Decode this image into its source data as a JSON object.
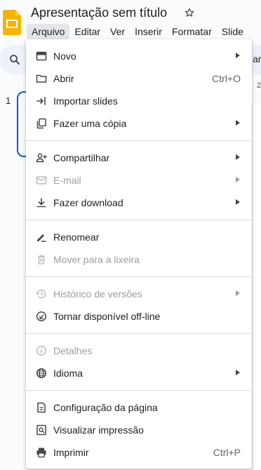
{
  "app": {
    "title": "Apresentação sem título"
  },
  "menubar": {
    "items": [
      "Arquivo",
      "Editar",
      "Ver",
      "Inserir",
      "Formatar",
      "Slide"
    ]
  },
  "background": {
    "toolbar_tail": "ar",
    "filmstrip_number": "1",
    "ruler_number": "2"
  },
  "file_menu": {
    "items": [
      {
        "label": "Novo",
        "icon": "new-presentation-icon",
        "submenu": true,
        "disabled": false
      },
      {
        "label": "Abrir",
        "icon": "folder-icon",
        "shortcut": "Ctrl+O",
        "disabled": false
      },
      {
        "label": "Importar slides",
        "icon": "import-icon",
        "disabled": false
      },
      {
        "label": "Fazer uma cópia",
        "icon": "copy-icon",
        "submenu": true,
        "disabled": false
      },
      {
        "label": "Compartilhar",
        "icon": "share-person-icon",
        "submenu": true,
        "disabled": false
      },
      {
        "label": "E-mail",
        "icon": "mail-icon",
        "submenu": true,
        "disabled": true
      },
      {
        "label": "Fazer download",
        "icon": "download-icon",
        "submenu": true,
        "disabled": false
      },
      {
        "label": "Renomear",
        "icon": "rename-icon",
        "disabled": false
      },
      {
        "label": "Mover para a lixeira",
        "icon": "trash-icon",
        "disabled": true
      },
      {
        "label": "Histórico de versões",
        "icon": "history-icon",
        "submenu": true,
        "disabled": true
      },
      {
        "label": "Tornar disponível off-line",
        "icon": "offline-icon",
        "disabled": false
      },
      {
        "label": "Detalhes",
        "icon": "info-icon",
        "disabled": true
      },
      {
        "label": "Idioma",
        "icon": "globe-icon",
        "submenu": true,
        "disabled": false
      },
      {
        "label": "Configuração da página",
        "icon": "page-setup-icon",
        "disabled": false
      },
      {
        "label": "Visualizar impressão",
        "icon": "print-preview-icon",
        "disabled": false
      },
      {
        "label": "Imprimir",
        "icon": "printer-icon",
        "shortcut": "Ctrl+P",
        "disabled": false
      }
    ]
  }
}
